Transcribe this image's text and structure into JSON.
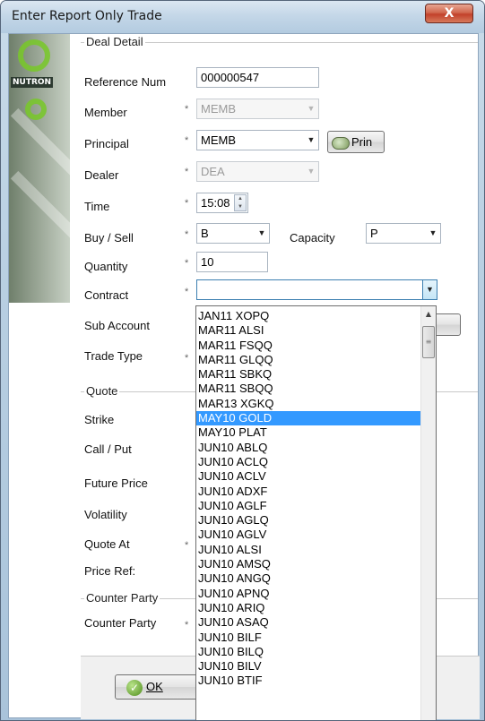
{
  "window": {
    "title": "Enter Report Only Trade",
    "close_label": "X"
  },
  "logo": {
    "text": "NUTRON"
  },
  "deal_detail": {
    "group_label": "Deal Detail",
    "reference_num": {
      "label": "Reference Num",
      "value": "000000547"
    },
    "member": {
      "label": "Member",
      "value": "MEMB"
    },
    "principal": {
      "label": "Principal",
      "value": "MEMB",
      "button": "Prin"
    },
    "dealer": {
      "label": "Dealer",
      "value": "DEA"
    },
    "time": {
      "label": "Time",
      "value": "15:08"
    },
    "buy_sell": {
      "label": "Buy / Sell",
      "value": "B"
    },
    "capacity": {
      "label": "Capacity",
      "value": "P"
    },
    "quantity": {
      "label": "Quantity",
      "value": "10"
    },
    "contract": {
      "label": "Contract",
      "value": ""
    },
    "sub_account": {
      "label": "Sub Account"
    },
    "trade_type": {
      "label": "Trade Type"
    }
  },
  "quote": {
    "group_label": "Quote",
    "strike": "Strike",
    "call_put": "Call / Put",
    "future_price": "Future Price",
    "volatility": "Volatility",
    "quote_at": "Quote At",
    "price_ref": "Price Ref:"
  },
  "counter_party": {
    "group_label": "Counter Party",
    "label": "Counter Party"
  },
  "required_mark": "*",
  "ok_button": "OK",
  "contract_dropdown": {
    "selected_index": 8,
    "items": [
      "JAN11 XOPQ",
      "MAR11 ALSI",
      "MAR11 FSQQ",
      "MAR11 GLQQ",
      "MAR11 SBKQ",
      "MAR11 SBQQ",
      "MAR13 XGKQ",
      "MAY10 GOLD",
      "MAY10 PLAT",
      "JUN10 ABLQ",
      "JUN10 ACLQ",
      "JUN10 ACLV",
      "JUN10 ADXF",
      "JUN10 AGLF",
      "JUN10 AGLQ",
      "JUN10 AGLV",
      "JUN10 ALSI",
      "JUN10 AMSQ",
      "JUN10 ANGQ",
      "JUN10 APNQ",
      "JUN10 ARIQ",
      "JUN10 ASAQ",
      "JUN10 BILF",
      "JUN10 BILQ",
      "JUN10 BILV",
      "JUN10 BTIF"
    ]
  }
}
